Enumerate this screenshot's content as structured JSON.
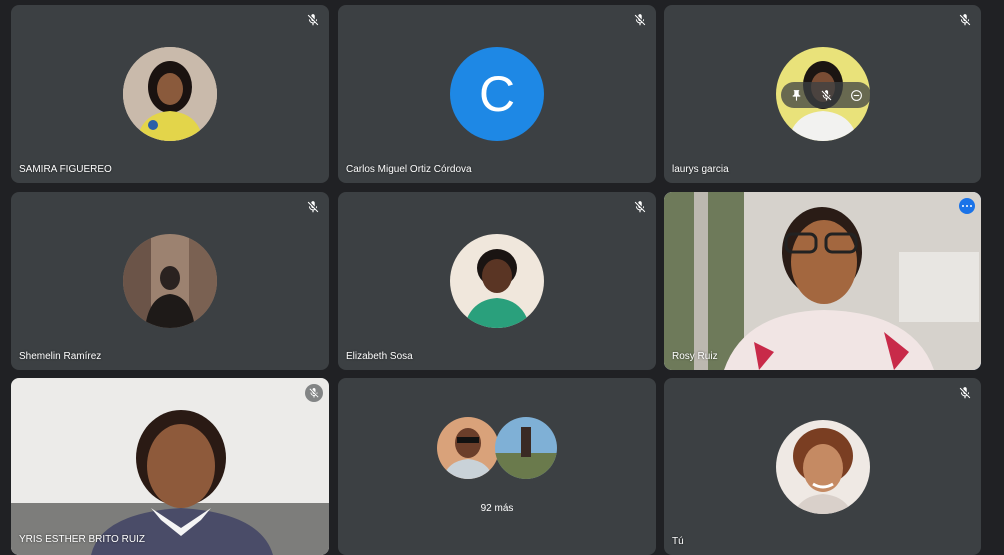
{
  "participants": [
    {
      "name": "SAMIRA FIGUEREO"
    },
    {
      "name": "Carlos Miguel Ortiz Córdova",
      "initial": "C"
    },
    {
      "name": "laurys garcia"
    },
    {
      "name": "Shemelin Ramírez"
    },
    {
      "name": "Elizabeth Sosa"
    },
    {
      "name": "Rosy Ruiz"
    },
    {
      "name": "YRIS ESTHER BRITO RUIZ"
    },
    {
      "name": "Tú"
    }
  ],
  "overflow": {
    "label": "92 más"
  },
  "colors": {
    "background": "#202124",
    "tile": "#3c4043",
    "accent": "#1a73e8",
    "speaking_outline": "#8ab4f8"
  },
  "icons": {
    "muted": "mic-off-icon",
    "more": "more-options-icon",
    "pin": "pin-icon",
    "remove": "remove-icon"
  }
}
